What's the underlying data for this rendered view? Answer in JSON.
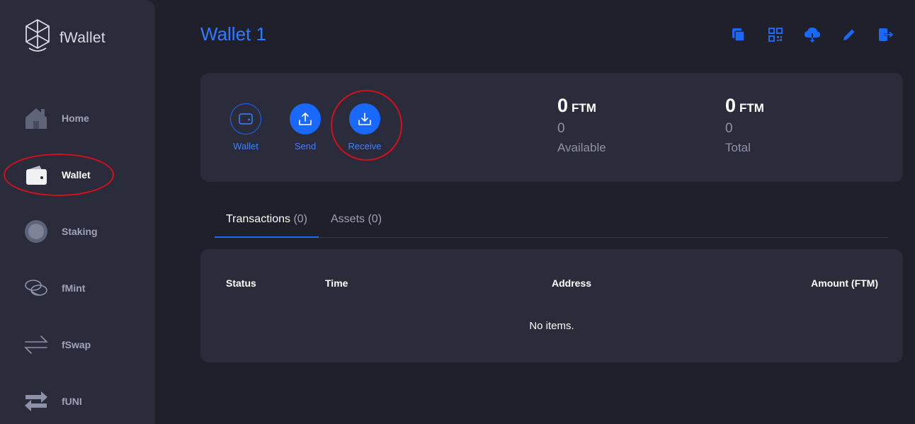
{
  "app": {
    "name": "fWallet"
  },
  "sidebar": {
    "items": [
      {
        "label": "Home",
        "icon": "home-icon"
      },
      {
        "label": "Wallet",
        "icon": "wallet-icon",
        "active": true
      },
      {
        "label": "Staking",
        "icon": "staking-icon"
      },
      {
        "label": "fMint",
        "icon": "coins-icon"
      },
      {
        "label": "fSwap",
        "icon": "swap-icon"
      },
      {
        "label": "fUNI",
        "icon": "transfer-arrows-icon"
      }
    ]
  },
  "header": {
    "title": "Wallet 1",
    "tools": [
      "copy-icon",
      "qr-code-icon",
      "cloud-download-icon",
      "pencil-icon",
      "logout-icon"
    ]
  },
  "actions": {
    "wallet_label": "Wallet",
    "send_label": "Send",
    "receive_label": "Receive"
  },
  "balances": {
    "available": {
      "value": "0",
      "unit": "FTM",
      "sub": "0",
      "caption": "Available"
    },
    "total": {
      "value": "0",
      "unit": "FTM",
      "sub": "0",
      "caption": "Total"
    }
  },
  "tabs": {
    "transactions": {
      "label": "Transactions",
      "count": "(0)"
    },
    "assets": {
      "label": "Assets",
      "count": "(0)"
    }
  },
  "table": {
    "columns": [
      "Status",
      "Time",
      "Address",
      "Amount (FTM)"
    ],
    "empty_text": "No items."
  },
  "colors": {
    "accent": "#1969ff",
    "annotation": "#d4101a",
    "background": "#1f202b",
    "card": "#2b2c3b"
  }
}
